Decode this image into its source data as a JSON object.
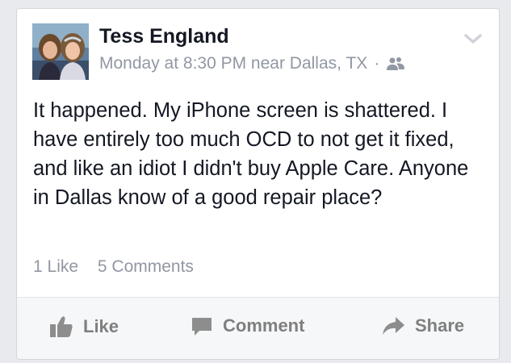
{
  "post": {
    "author": "Tess England",
    "timestamp": "Monday at 8:30 PM near Dallas, TX",
    "separator": "·",
    "audience_icon": "friends-icon",
    "menu_icon": "chevron-down-icon",
    "text": "It happened. My iPhone screen is shattered. I have entirely too much OCD to not get it fixed, and like an idiot I didn't buy Apple Care. Anyone in Dallas know of a good repair place?",
    "likes_label": "1 Like",
    "comments_label": "5 Comments"
  },
  "actions": {
    "like_label": "Like",
    "comment_label": "Comment",
    "share_label": "Share",
    "like_icon": "thumbs-up-icon",
    "comment_icon": "speech-bubble-icon",
    "share_icon": "share-arrow-icon"
  },
  "colors": {
    "background": "#e9eaed",
    "card": "#ffffff",
    "text": "#141823",
    "muted": "#9197a3",
    "action": "#7f7f7f"
  }
}
